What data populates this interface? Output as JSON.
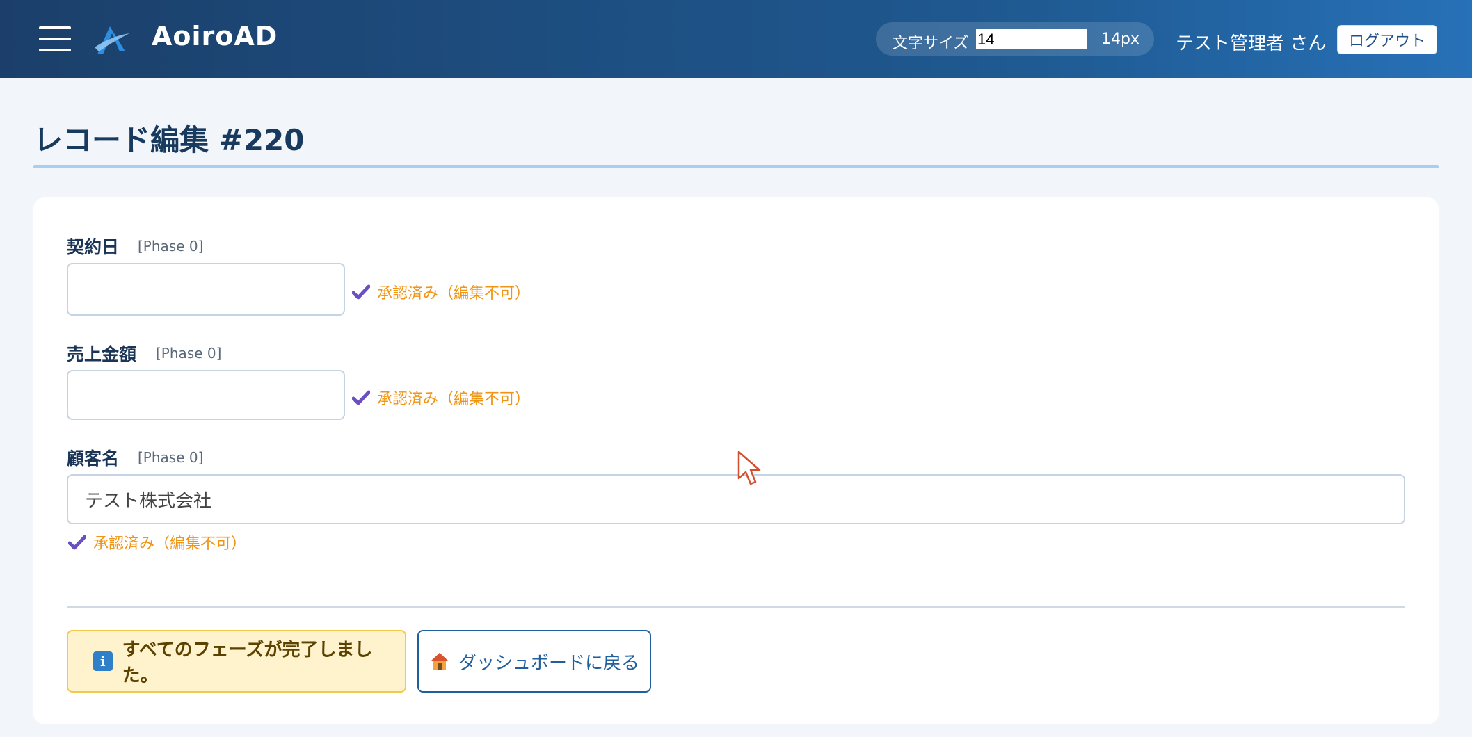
{
  "header": {
    "brand": "AoiroAD",
    "font_size_label": "文字サイズ",
    "font_size_value": "14",
    "font_size_unit": "14px",
    "user_name": "テスト管理者 さん",
    "logout_label": "ログアウト"
  },
  "page": {
    "title": "レコード編集 #220"
  },
  "fields": [
    {
      "label": "契約日",
      "phase": "[Phase 0]",
      "value": "",
      "status": "承認済み（編集不可）"
    },
    {
      "label": "売上金額",
      "phase": "[Phase 0]",
      "value": "",
      "status": "承認済み（編集不可）"
    },
    {
      "label": "顧客名",
      "phase": "[Phase 0]",
      "value": "テスト株式会社",
      "status": "承認済み（編集不可）"
    }
  ],
  "footer": {
    "info_message": "すべてのフェーズが完了しました。",
    "dashboard_label": "ダッシュボードに戻る"
  },
  "colors": {
    "header_start": "#1b3f6a",
    "header_end": "#2771b8",
    "approved_text": "#f09414",
    "check_mark": "#6a4fc0",
    "info_bg": "#fff3cd",
    "primary": "#1f5f9e"
  }
}
